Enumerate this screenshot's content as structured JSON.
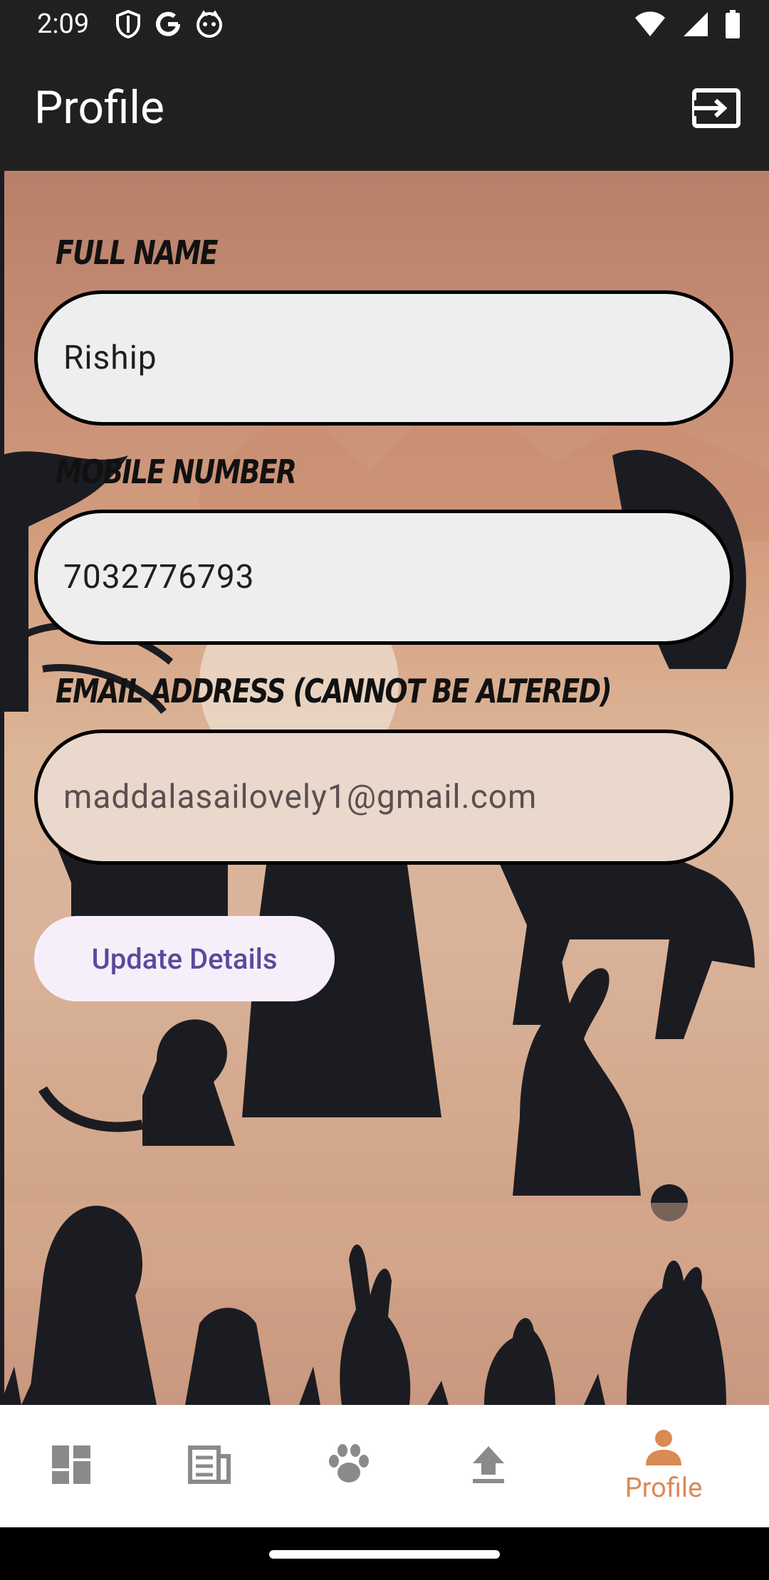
{
  "status_bar": {
    "time": "2:09",
    "left_icons": [
      "shield-icon",
      "google-icon",
      "cat-face-icon"
    ],
    "right_icons": [
      "wifi-icon",
      "signal-icon",
      "battery-icon"
    ]
  },
  "app_bar": {
    "title": "Profile",
    "action_icon": "logout-icon"
  },
  "form": {
    "full_name": {
      "label": "FULL NAME",
      "value": "Riship"
    },
    "mobile": {
      "label": "MOBILE NUMBER",
      "value": "7032776793"
    },
    "email": {
      "label": "EMAIL ADDRESS (CANNOT BE ALTERED)",
      "value": "maddalasailovely1@gmail.com",
      "editable": false
    },
    "update_button": "Update Details"
  },
  "bottom_nav": {
    "items": [
      {
        "icon": "dashboard-icon",
        "label": "",
        "active": false
      },
      {
        "icon": "feed-icon",
        "label": "",
        "active": false
      },
      {
        "icon": "paw-icon",
        "label": "",
        "active": false
      },
      {
        "icon": "upload-icon",
        "label": "",
        "active": false
      },
      {
        "icon": "person-icon",
        "label": "Profile",
        "active": true
      }
    ]
  },
  "colors": {
    "bar": "#212021",
    "accent": "#d98a55",
    "button_text": "#5a4a9c",
    "nav_icon": "#8a8a8a"
  }
}
